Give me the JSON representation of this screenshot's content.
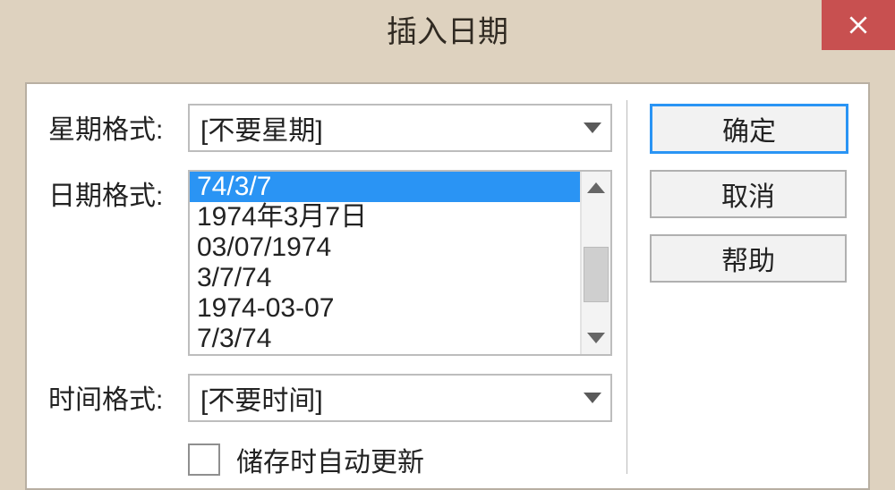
{
  "title": "插入日期",
  "labels": {
    "week_format": "星期格式:",
    "date_format": "日期格式:",
    "time_format": "时间格式:"
  },
  "week_combo": {
    "value": "[不要星期]"
  },
  "date_list": {
    "selected_index": 0,
    "items": [
      "74/3/7",
      "1974年3月7日",
      "03/07/1974",
      "3/7/74",
      "1974-03-07",
      "7/3/74"
    ]
  },
  "time_combo": {
    "value": "[不要时间]"
  },
  "checkbox": {
    "label": "储存时自动更新",
    "checked": false
  },
  "buttons": {
    "ok": "确定",
    "cancel": "取消",
    "help": "帮助"
  }
}
